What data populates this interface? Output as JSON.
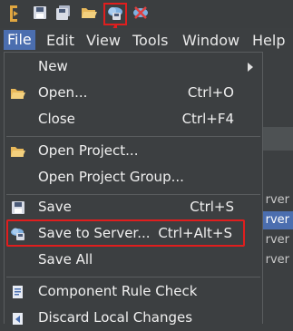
{
  "menubar": {
    "items": [
      "File",
      "Edit",
      "View",
      "Tools",
      "Window",
      "Help"
    ]
  },
  "file_menu": {
    "new": "New",
    "open": "Open...",
    "open_shortcut": "Ctrl+O",
    "close": "Close",
    "close_shortcut": "Ctrl+F4",
    "open_project": "Open Project...",
    "open_project_group": "Open Project Group...",
    "save": "Save",
    "save_shortcut": "Ctrl+S",
    "save_to_server": "Save to Server...",
    "save_to_server_shortcut": "Ctrl+Alt+S",
    "save_all": "Save All",
    "component_rule_check": "Component Rule Check",
    "discard_local_changes": "Discard Local Changes"
  },
  "background_rows": [
    "rver",
    "rver",
    "rver",
    "rver"
  ],
  "colors": {
    "highlight": "#e01e1e",
    "menu_active": "#4b6eaf",
    "background": "#3c3f41"
  },
  "icons": [
    "app-logo-icon",
    "save-icon",
    "save-all-icon",
    "open-folder-icon",
    "save-to-server-icon",
    "disconnect-icon"
  ]
}
